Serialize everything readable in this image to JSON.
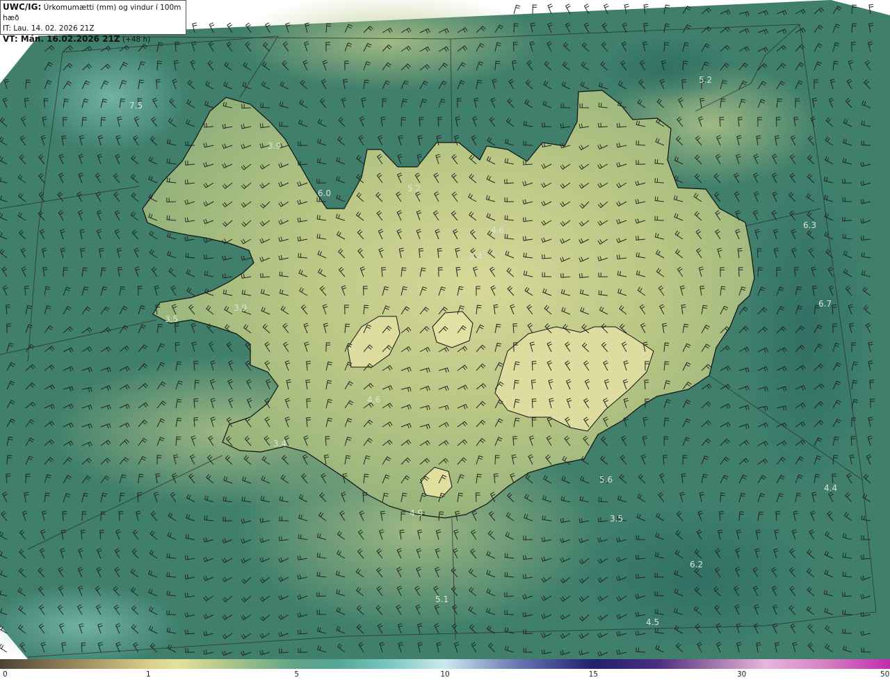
{
  "header": {
    "line1_bold": "UWC/IG:",
    "line1_rest": " Úrkomumætti (mm) og vindur í 100m hæð",
    "line2": "IT: Lau. 14. 02. 2026 21Z",
    "line3_bold": "VT: Mán. 16.02.2026 21Z",
    "line3_rest": " (+48 h)"
  },
  "map": {
    "labels": [
      {
        "text": "7.5"
      },
      {
        "text": "3.9"
      },
      {
        "text": "6.0"
      },
      {
        "text": "5.2"
      },
      {
        "text": "4.6"
      },
      {
        "text": "2.4"
      },
      {
        "text": "5.2"
      },
      {
        "text": "6.3"
      },
      {
        "text": "6.7"
      },
      {
        "text": "3.9"
      },
      {
        "text": "3.5"
      },
      {
        "text": "4.6"
      },
      {
        "text": "3.4"
      },
      {
        "text": "5.6"
      },
      {
        "text": "3.5"
      },
      {
        "text": "4.9"
      },
      {
        "text": "4.4"
      },
      {
        "text": "6.2"
      },
      {
        "text": "5.1"
      },
      {
        "text": "4.5"
      }
    ]
  },
  "colorbar": {
    "ticks": [
      {
        "label": "0",
        "value": 0
      },
      {
        "label": "1",
        "value": 1
      },
      {
        "label": "5",
        "value": 5
      },
      {
        "label": "10",
        "value": 10
      },
      {
        "label": "15",
        "value": 15
      },
      {
        "label": "30",
        "value": 30
      },
      {
        "label": "50",
        "value": 50
      }
    ]
  },
  "colors": {
    "sea": "#3f7f6c",
    "land_light": "#c8cf8a",
    "coast_line": "#111111"
  }
}
